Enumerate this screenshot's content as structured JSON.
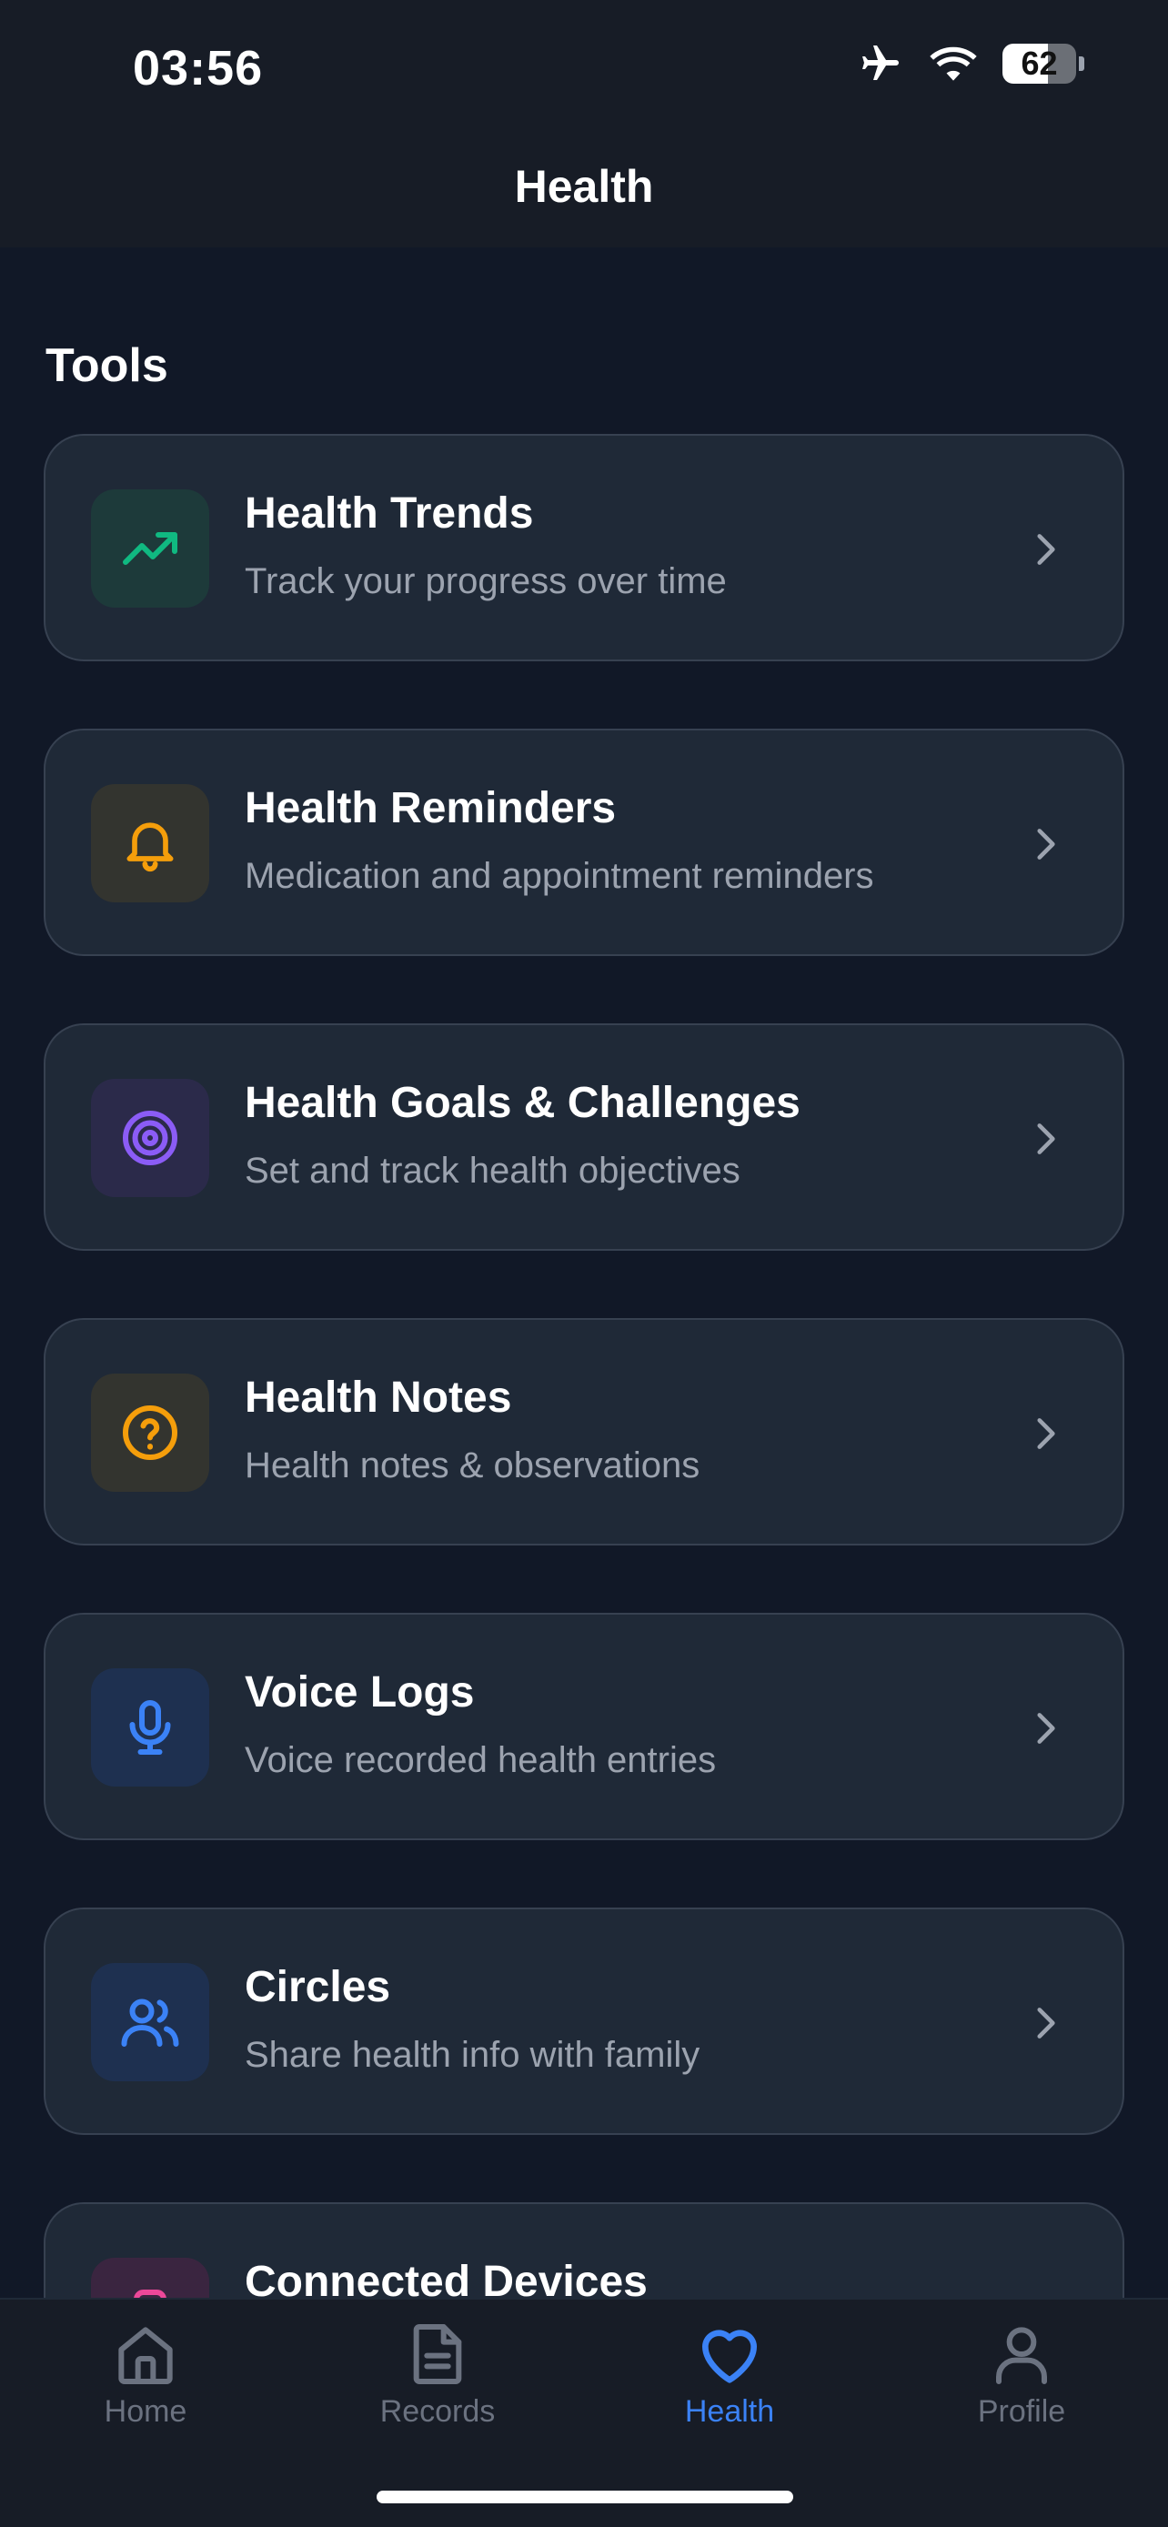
{
  "status_bar": {
    "time": "03:56",
    "battery": "62",
    "icons": [
      "airplane-icon",
      "wifi-icon",
      "battery-icon"
    ]
  },
  "header": {
    "title": "Health"
  },
  "section": {
    "title": "Tools"
  },
  "tools": [
    {
      "title": "Health Trends",
      "subtitle": "Track your progress over time",
      "icon": "trend-up-icon",
      "accent": "#10b981",
      "tile": "#1d3a3a"
    },
    {
      "title": "Health Reminders",
      "subtitle": "Medication and appointment reminders",
      "icon": "bell-icon",
      "accent": "#f59e0b",
      "tile": "#33342f"
    },
    {
      "title": "Health Goals & Challenges",
      "subtitle": "Set and track health objectives",
      "icon": "target-icon",
      "accent": "#8b5cf6",
      "tile": "#2b2a4a"
    },
    {
      "title": "Health Notes",
      "subtitle": "Health notes & observations",
      "icon": "question-circle-icon",
      "accent": "#f59e0b",
      "tile": "#33342f"
    },
    {
      "title": "Voice Logs",
      "subtitle": "Voice recorded health entries",
      "icon": "microphone-icon",
      "accent": "#3b82f6",
      "tile": "#1e3050"
    },
    {
      "title": "Circles",
      "subtitle": "Share health info with family",
      "icon": "users-icon",
      "accent": "#3b82f6",
      "tile": "#1e3050"
    },
    {
      "title": "Connected Devices",
      "subtitle": "",
      "icon": "device-icon",
      "accent": "#ec4899",
      "tile": "#3a2540"
    }
  ],
  "nav": {
    "items": [
      {
        "label": "Home",
        "icon": "home-icon",
        "active": false
      },
      {
        "label": "Records",
        "icon": "document-icon",
        "active": false
      },
      {
        "label": "Health",
        "icon": "heart-icon",
        "active": true
      },
      {
        "label": "Profile",
        "icon": "user-icon",
        "active": false
      }
    ],
    "active_color": "#3b82f6",
    "inactive_color": "#6b7280"
  }
}
